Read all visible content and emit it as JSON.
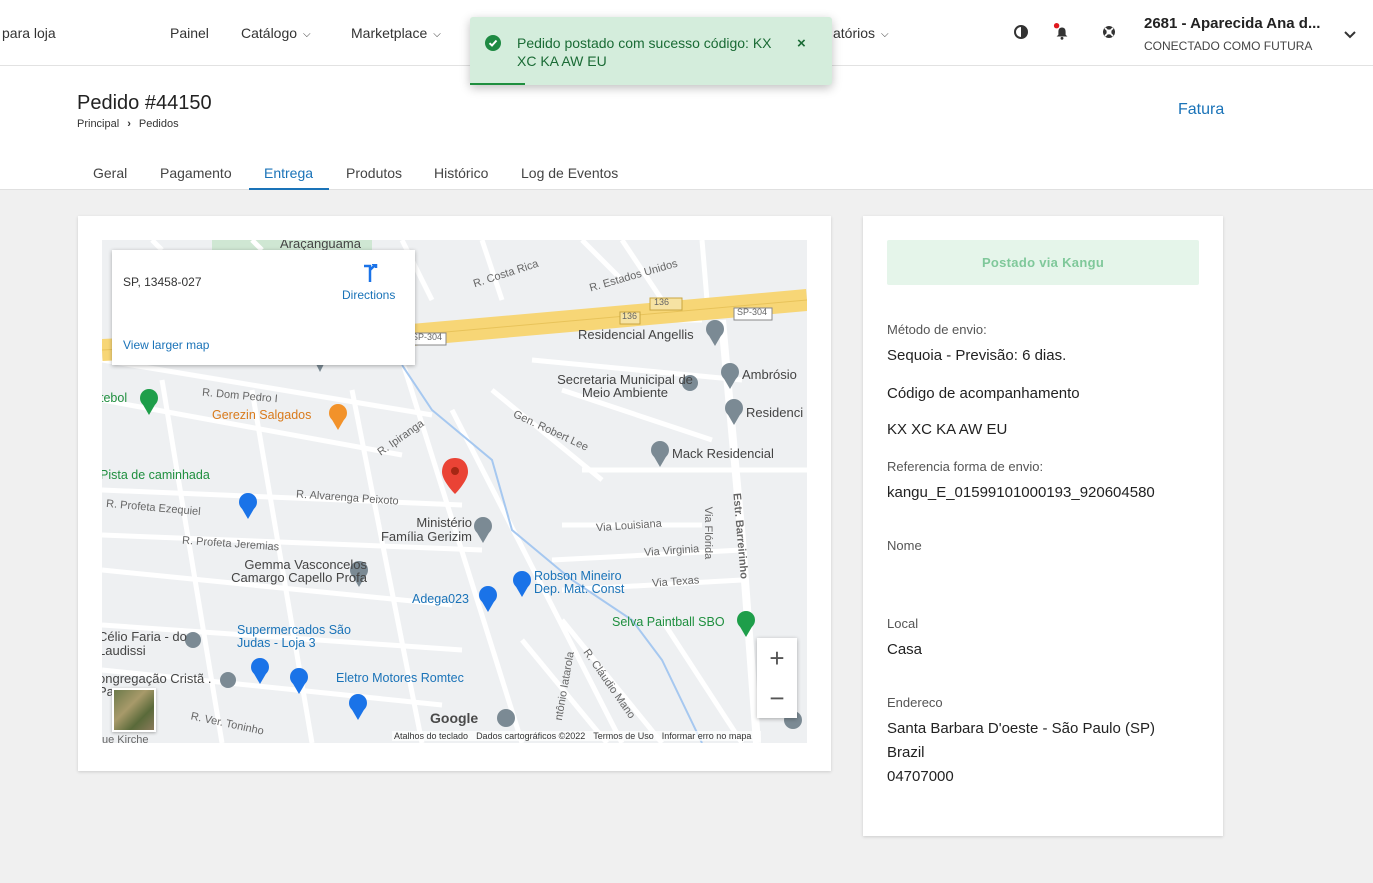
{
  "nav": {
    "back_label": "para loja",
    "painel": "Painel",
    "catalogo": "Catálogo",
    "marketplace": "Marketplace",
    "relatorios": "atórios",
    "account_name": "2681 - Aparecida Ana d...",
    "account_sub": "CONECTADO COMO FUTURA"
  },
  "toast": {
    "message": "Pedido postado com sucesso código: KX XC KA AW EU",
    "close": "×"
  },
  "header": {
    "title": "Pedido #44150",
    "breadcrumb_home": "Principal",
    "breadcrumb_sep": "›",
    "breadcrumb_current": "Pedidos",
    "invoice_link": "Fatura",
    "tabs": [
      "Geral",
      "Pagamento",
      "Entrega",
      "Produtos",
      "Histórico",
      "Log de Eventos"
    ],
    "active_tab": "Entrega"
  },
  "map": {
    "info_address": "SP, 13458-027",
    "directions": "Directions",
    "view_larger": "View larger map",
    "google": "Google",
    "attribution": [
      "Atalhos do teclado",
      "Dados cartográficos ©2022",
      "Termos de Uso",
      "Informar erro no mapa"
    ],
    "zoom_in": "+",
    "zoom_out": "−",
    "places": {
      "residencial_angellis": "Residencial Angellis",
      "ambrosio": "Ambrósio",
      "secretaria": "Secretaria Municipal de Meio Ambiente",
      "residencial": "Residenci",
      "mack": "Mack Residencial",
      "gerezin": "Gerezin Salgados",
      "futebol": "tebol",
      "pista": "Pista de caminhada",
      "ministerio": "Ministério Família Gerizim",
      "gemma": "Gemma Vasconcelos Camargo Capello Profa",
      "adega": "Adega023",
      "robson": "Robson Mineiro Dep. Mat. Const",
      "selva": "Selva Paintball SBO",
      "celio": "Célio Faria - do Laudissi",
      "supermercados": "Supermercados São Judas - Loja 3",
      "eletro": "Eletro Motores Romtec",
      "congregacao": "ongregação Cristã . Parque...",
      "aracanguama": "Araçanguama"
    },
    "streets": {
      "costa_rica": "R. Costa Rica",
      "estados_unidos": "R. Estados Unidos",
      "dom_pedro": "R. Dom Pedro I",
      "ipiranga": "R. Ipiranga",
      "alvarenga": "R. Alvarenga Peixoto",
      "profeta_ezequiel": "R. Profeta Ezequiel",
      "profeta_jeremias": "R. Profeta Jeremias",
      "gen_robert": "Gen. Robert Lee",
      "louisiana": "Via Louisiana",
      "virginia": "Via Virginia",
      "texas": "Via Texas",
      "florida": "Via Flórida",
      "barreirinho": "Estr. Barreirinho",
      "sp304a": "SP-304",
      "sp304b": "SP-304",
      "r136": "136",
      "ver_toninho": "R. Ver. Toninho",
      "kirche": "ue Kirche",
      "iatarola": "ntônio Iatarola",
      "claudio": "R. Cláudio Mano"
    }
  },
  "shipping": {
    "status": "Postado via Kangu",
    "method_label": "Método de envio:",
    "method_value": "Sequoia - Previsão: 6 dias.",
    "tracking_label": "Código de acompanhamento",
    "tracking_value": "KX XC KA AW EU",
    "ref_label": "Referencia forma de envio:",
    "ref_value": "kangu_E_01599101000193_920604580",
    "name_label": "Nome",
    "name_value": "",
    "local_label": "Local",
    "local_value": "Casa",
    "address_label": "Endereco",
    "address_line1": "Santa Barbara D'oeste - São Paulo (SP)",
    "address_line2": "Brazil",
    "address_line3": "04707000"
  },
  "colors": {
    "primary": "#1a73b8",
    "success_bg": "#d4eddc",
    "success_text": "#1a6b35",
    "status_btn_bg": "#e5f5ea"
  }
}
